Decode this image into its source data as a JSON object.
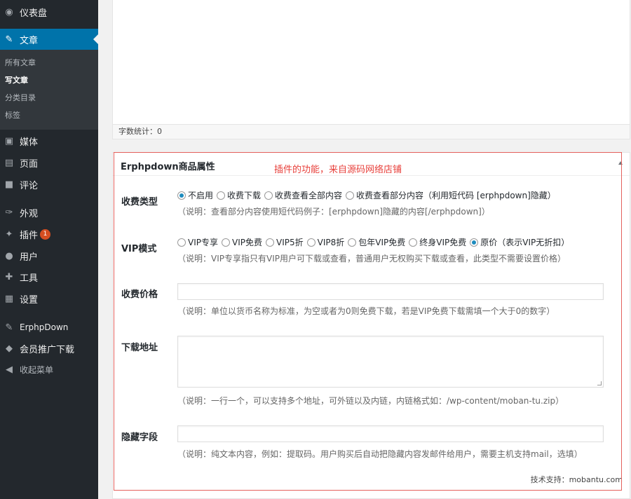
{
  "sidebar": {
    "items": [
      {
        "icon": "dashboard-icon",
        "glyph": "◉",
        "label": "仪表盘"
      },
      {
        "icon": "pin-icon",
        "glyph": "✎",
        "label": "文章"
      },
      {
        "icon": "media-icon",
        "glyph": "▣",
        "label": "媒体"
      },
      {
        "icon": "page-icon",
        "glyph": "▤",
        "label": "页面"
      },
      {
        "icon": "comment-icon",
        "glyph": "■",
        "label": "评论"
      },
      {
        "icon": "appearance-icon",
        "glyph": "✑",
        "label": "外观"
      },
      {
        "icon": "plugin-icon",
        "glyph": "✦",
        "label": "插件"
      },
      {
        "icon": "user-icon",
        "glyph": "●",
        "label": "用户"
      },
      {
        "icon": "tools-icon",
        "glyph": "✚",
        "label": "工具"
      },
      {
        "icon": "settings-icon",
        "glyph": "▦",
        "label": "设置"
      },
      {
        "icon": "erphpdown-icon",
        "glyph": "✎",
        "label": "ErphpDown"
      },
      {
        "icon": "shield-icon",
        "glyph": "◆",
        "label": "会员推广下载"
      },
      {
        "icon": "collapse-icon",
        "glyph": "◀",
        "label": "收起菜单"
      }
    ],
    "plugin_badge": "1",
    "submenu": [
      "所有文章",
      "写文章",
      "分类目录",
      "标签"
    ]
  },
  "editor": {
    "word_count": "字数统计：0"
  },
  "metabox": {
    "title": "Erphpdown商品属性",
    "note": "插件的功能，来自源码网络店铺",
    "fee_type": {
      "label": "收费类型",
      "options": [
        "不启用",
        "收费下载",
        "收费查看全部内容",
        "收费查看部分内容（利用短代码 [erphpdown]隐藏）"
      ],
      "selected": "不启用",
      "desc": "（说明：查看部分内容使用短代码例子：[erphpdown]隐藏的内容[/erphpdown]）"
    },
    "vip_mode": {
      "label": "VIP模式",
      "options": [
        "VIP专享",
        "VIP免费",
        "VIP5折",
        "VIP8折",
        "包年VIP免费",
        "终身VIP免费",
        "原价（表示VIP无折扣）"
      ],
      "selected": "原价（表示VIP无折扣）",
      "desc": "（说明：VIP专享指只有VIP用户可下载或查看，普通用户无权购买下载或查看，此类型不需要设置价格）"
    },
    "price": {
      "label": "收费价格",
      "value": "",
      "desc": "（说明：单位以货币名称为标准，为空或者为0则免费下载，若是VIP免费下载需填一个大于0的数字）"
    },
    "download": {
      "label": "下载地址",
      "value": "",
      "desc": "（说明：一行一个，可以支持多个地址，可外链以及内链，内链格式如：/wp-content/moban-tu.zip）"
    },
    "hidden": {
      "label": "隐藏字段",
      "value": "",
      "desc": "（说明：纯文本内容，例如：提取码。用户购买后自动把隐藏内容发邮件给用户，需要主机支持mail，选填）"
    },
    "support": "技术支持：mobantu.com"
  }
}
